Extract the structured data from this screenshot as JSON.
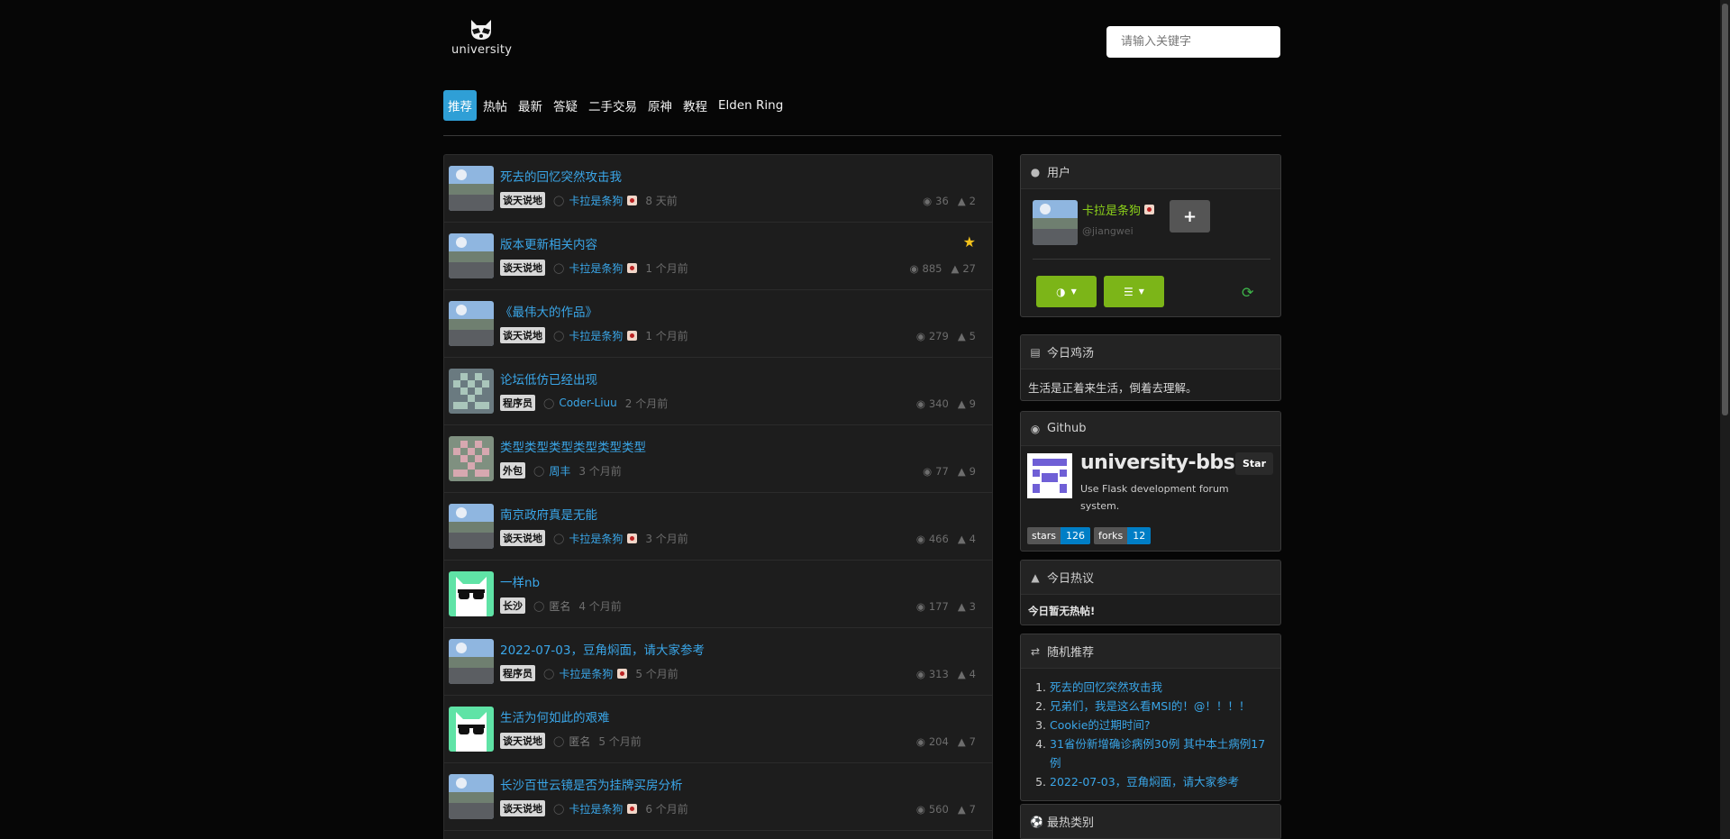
{
  "header": {
    "logo_text": "university",
    "search_placeholder": "请输入关键字"
  },
  "nav": {
    "items": [
      "推荐",
      "热帖",
      "最新",
      "答疑",
      "二手交易",
      "原神",
      "教程",
      "Elden Ring"
    ],
    "active_index": 0
  },
  "posts": [
    {
      "title": "死去的回忆突然攻击我",
      "tag": "谈天说地",
      "author": "卡拉是条狗",
      "time": "8 天前",
      "views": "36",
      "comments": "2",
      "avatar": "landscape",
      "starred": false,
      "anon": false
    },
    {
      "title": "版本更新相关内容",
      "tag": "谈天说地",
      "author": "卡拉是条狗",
      "time": "1 个月前",
      "views": "885",
      "comments": "27",
      "avatar": "landscape",
      "starred": true,
      "anon": false
    },
    {
      "title": "《最伟大的作品》",
      "tag": "谈天说地",
      "author": "卡拉是条狗",
      "time": "1 个月前",
      "views": "279",
      "comments": "5",
      "avatar": "landscape",
      "starred": false,
      "anon": false
    },
    {
      "title": "论坛低仿已经出现",
      "tag": "程序员",
      "author": "Coder-Liuu",
      "time": "2 个月前",
      "views": "340",
      "comments": "9",
      "avatar": "identicon-gray",
      "starred": false,
      "anon": false
    },
    {
      "title": "类型类型类型类型类型类型",
      "tag": "外包",
      "author": "周丰",
      "time": "3 个月前",
      "views": "77",
      "comments": "9",
      "avatar": "identicon-pink",
      "starred": false,
      "anon": false
    },
    {
      "title": "南京政府真是无能",
      "tag": "谈天说地",
      "author": "卡拉是条狗",
      "time": "3 个月前",
      "views": "466",
      "comments": "4",
      "avatar": "landscape",
      "starred": false,
      "anon": false
    },
    {
      "title": "一样nb",
      "tag": "长沙",
      "author": "匿名",
      "time": "4 个月前",
      "views": "177",
      "comments": "3",
      "avatar": "sunglasses",
      "starred": false,
      "anon": true
    },
    {
      "title": "2022-07-03，豆角焖面，请大家参考",
      "tag": "程序员",
      "author": "卡拉是条狗",
      "time": "5 个月前",
      "views": "313",
      "comments": "4",
      "avatar": "landscape",
      "starred": false,
      "anon": false
    },
    {
      "title": "生活为何如此的艰难",
      "tag": "谈天说地",
      "author": "匿名",
      "time": "5 个月前",
      "views": "204",
      "comments": "7",
      "avatar": "sunglasses",
      "starred": false,
      "anon": true
    },
    {
      "title": "长沙百世云镜是否为挂牌买房分析",
      "tag": "谈天说地",
      "author": "卡拉是条狗",
      "time": "6 个月前",
      "views": "560",
      "comments": "7",
      "avatar": "landscape",
      "starred": false,
      "anon": false
    }
  ],
  "sidebar": {
    "user": {
      "heading": "用户",
      "name": "卡拉是条狗",
      "handle": "@jiangwei",
      "add_label": "+"
    },
    "quote": {
      "heading": "今日鸡汤",
      "text": "生活是正着来生活，倒着去理解。"
    },
    "github": {
      "heading": "Github",
      "repo": "university-bbs",
      "description": "Use Flask development forum system.",
      "star_label": "Star",
      "stars_key": "stars",
      "stars_value": "126",
      "forks_key": "forks",
      "forks_value": "12"
    },
    "hot": {
      "heading": "今日热议",
      "text": "今日暂无热帖!"
    },
    "random": {
      "heading": "随机推荐",
      "items": [
        "死去的回忆突然攻击我",
        "兄弟们，我是这么看MSI的！@！！！！",
        "Cookie的过期时间?",
        "31省份新增确诊病例30例 其中本土病例17例",
        "2022-07-03，豆角焖面，请大家参考"
      ]
    },
    "categories": {
      "heading": "最热类别"
    }
  },
  "colors": {
    "accent": "#2f9fd6",
    "link": "#3aa6e8",
    "green": "#7cb518",
    "star": "#f3c21b"
  }
}
